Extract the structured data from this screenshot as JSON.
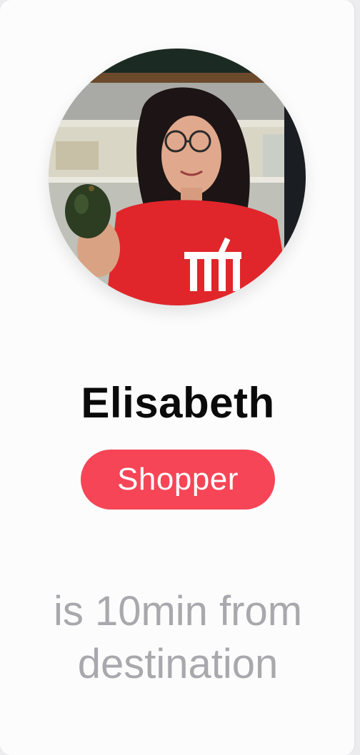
{
  "shopper": {
    "name": "Elisabeth",
    "role_badge": "Shopper",
    "status_line_1": "is 10min from",
    "status_line_2": "destination"
  },
  "colors": {
    "badge_background": "#f64556",
    "name_text": "#0a0a0a",
    "status_text": "#a8a8ad",
    "card_background": "#fcfcfd"
  },
  "avatar": {
    "icon": "shopper-photo"
  }
}
